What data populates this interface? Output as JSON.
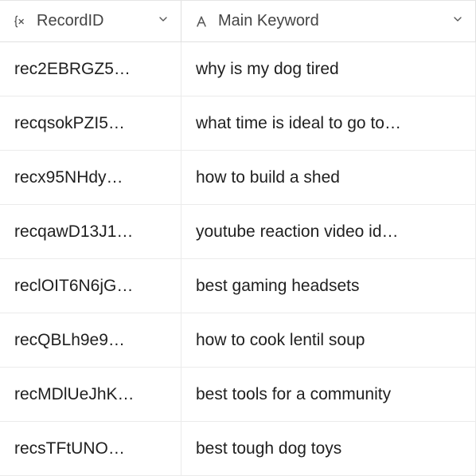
{
  "columns": {
    "recordId": {
      "label": "RecordID"
    },
    "mainKeyword": {
      "label": "Main Keyword"
    }
  },
  "rows": [
    {
      "recordId": "rec2EBRGZ5…",
      "mainKeyword": "why is my dog tired"
    },
    {
      "recordId": "recqsokPZI5…",
      "mainKeyword": "what time is ideal to go to…"
    },
    {
      "recordId": "recx95NHdy…",
      "mainKeyword": "how to build a shed"
    },
    {
      "recordId": "recqawD13J1…",
      "mainKeyword": "youtube reaction video id…"
    },
    {
      "recordId": "reclOIT6N6jG…",
      "mainKeyword": "best gaming headsets"
    },
    {
      "recordId": "recQBLh9e9…",
      "mainKeyword": "how to cook lentil soup"
    },
    {
      "recordId": "recMDlUeJhK…",
      "mainKeyword": "best tools for a community"
    },
    {
      "recordId": "recsTFtUNO…",
      "mainKeyword": "best tough dog toys"
    }
  ]
}
